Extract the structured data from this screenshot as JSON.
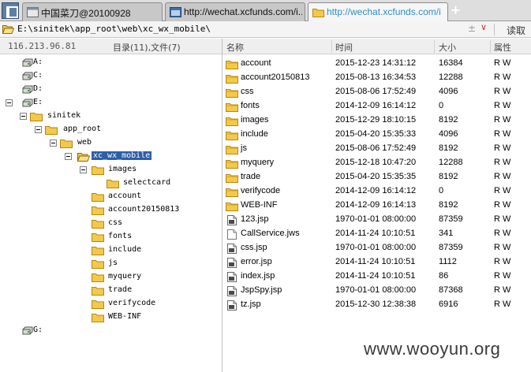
{
  "tabs": [
    {
      "title": "中国菜刀@20100928",
      "active": false
    },
    {
      "title": "http://wechat.xcfunds.com/i...",
      "active": false
    },
    {
      "title": "http://wechat.xcfunds.com/i...",
      "active": true
    }
  ],
  "new_tab_label": "+",
  "address": {
    "path": "E:\\sinitek\\app_root\\web\\xc_wx_mobile\\",
    "extra_glyph": "±",
    "dropdown_glyph": "∨",
    "go_label": "读取"
  },
  "left_header": {
    "ip": "116.213.96.81",
    "dir_info": "目录(11),文件(7)"
  },
  "tree": [
    {
      "label": "A:",
      "kind": "drive"
    },
    {
      "label": "C:",
      "kind": "drive"
    },
    {
      "label": "D:",
      "kind": "drive"
    },
    {
      "label": "E:",
      "kind": "drive"
    },
    {
      "label": "sinitek",
      "kind": "folder"
    },
    {
      "label": "app_root",
      "kind": "folder"
    },
    {
      "label": "web",
      "kind": "folder"
    },
    {
      "label": "xc_wx_mobile",
      "kind": "folder-open",
      "selected": true
    },
    {
      "label": "images",
      "kind": "folder"
    },
    {
      "label": "selectcard",
      "kind": "folder"
    },
    {
      "label": "account",
      "kind": "folder"
    },
    {
      "label": "account20150813",
      "kind": "folder"
    },
    {
      "label": "css",
      "kind": "folder"
    },
    {
      "label": "fonts",
      "kind": "folder"
    },
    {
      "label": "include",
      "kind": "folder"
    },
    {
      "label": "js",
      "kind": "folder"
    },
    {
      "label": "myquery",
      "kind": "folder"
    },
    {
      "label": "trade",
      "kind": "folder"
    },
    {
      "label": "verifycode",
      "kind": "folder"
    },
    {
      "label": "WEB-INF",
      "kind": "folder"
    },
    {
      "label": "G:",
      "kind": "drive"
    }
  ],
  "columns": {
    "name": "名称",
    "time": "时间",
    "size": "大小",
    "perm": "属性"
  },
  "files": [
    {
      "name": "account",
      "time": "2015-12-23 14:31:12",
      "size": "16384",
      "perm": "R W",
      "type": "folder"
    },
    {
      "name": "account20150813",
      "time": "2015-08-13 16:34:53",
      "size": "12288",
      "perm": "R W",
      "type": "folder"
    },
    {
      "name": "css",
      "time": "2015-08-06 17:52:49",
      "size": "4096",
      "perm": "R W",
      "type": "folder"
    },
    {
      "name": "fonts",
      "time": "2014-12-09 16:14:12",
      "size": "0",
      "perm": "R W",
      "type": "folder"
    },
    {
      "name": "images",
      "time": "2015-12-29 18:10:15",
      "size": "8192",
      "perm": "R W",
      "type": "folder"
    },
    {
      "name": "include",
      "time": "2015-04-20 15:35:33",
      "size": "4096",
      "perm": "R W",
      "type": "folder"
    },
    {
      "name": "js",
      "time": "2015-08-06 17:52:49",
      "size": "8192",
      "perm": "R W",
      "type": "folder"
    },
    {
      "name": "myquery",
      "time": "2015-12-18 10:47:20",
      "size": "12288",
      "perm": "R W",
      "type": "folder"
    },
    {
      "name": "trade",
      "time": "2015-04-20 15:35:35",
      "size": "8192",
      "perm": "R W",
      "type": "folder"
    },
    {
      "name": "verifycode",
      "time": "2014-12-09 16:14:12",
      "size": "0",
      "perm": "R W",
      "type": "folder"
    },
    {
      "name": "WEB-INF",
      "time": "2014-12-09 16:14:13",
      "size": "8192",
      "perm": "R W",
      "type": "folder"
    },
    {
      "name": "123.jsp",
      "time": "1970-01-01 08:00:00",
      "size": "87359",
      "perm": "R W",
      "type": "file"
    },
    {
      "name": "CallService.jws",
      "time": "2014-11-24 10:10:51",
      "size": "341",
      "perm": "R W",
      "type": "blank"
    },
    {
      "name": "css.jsp",
      "time": "1970-01-01 08:00:00",
      "size": "87359",
      "perm": "R W",
      "type": "file"
    },
    {
      "name": "error.jsp",
      "time": "2014-11-24 10:10:51",
      "size": "1112",
      "perm": "R W",
      "type": "file"
    },
    {
      "name": "index.jsp",
      "time": "2014-11-24 10:10:51",
      "size": "86",
      "perm": "R W",
      "type": "file"
    },
    {
      "name": "JspSpy.jsp",
      "time": "1970-01-01 08:00:00",
      "size": "87368",
      "perm": "R W",
      "type": "file"
    },
    {
      "name": "tz.jsp",
      "time": "2015-12-30 12:38:38",
      "size": "6916",
      "perm": "R W",
      "type": "file"
    }
  ],
  "watermark": "www.wooyun.org",
  "colors": {
    "folder": "#f2c94c",
    "folder_border": "#b8860b",
    "selection": "#2c5fa8",
    "active_tab_text": "#2d8fc8"
  }
}
